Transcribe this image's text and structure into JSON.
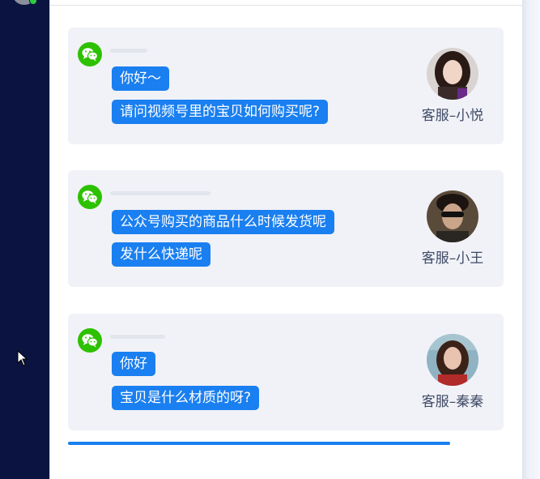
{
  "conversations": [
    {
      "messages": [
        "你好～",
        "请问视频号里的宝贝如何购买呢?"
      ],
      "agent_label": "客服–小悦",
      "channel_icon": "wechat-icon"
    },
    {
      "messages": [
        "公众号购买的商品什么时候发货呢",
        "发什么快递呢"
      ],
      "agent_label": "客服–小王",
      "channel_icon": "wechat-icon"
    },
    {
      "messages": [
        "你好",
        "宝贝是什么材质的呀?"
      ],
      "agent_label": "客服–秦秦",
      "channel_icon": "wechat-icon"
    }
  ],
  "progress": {
    "fraction": 1.0
  },
  "colors": {
    "sidebar": "#0b1440",
    "bubble": "#1a7ff0",
    "wechat_green": "#2dc100",
    "card_bg": "#f1f2f7",
    "online": "#2ecc40"
  }
}
